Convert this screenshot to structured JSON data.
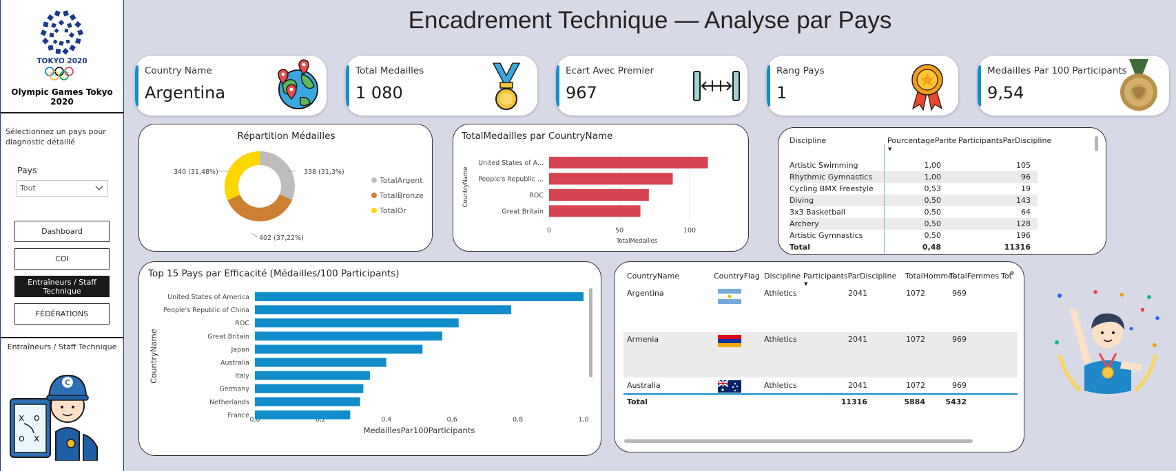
{
  "app": {
    "title": "Encadrement Technique — Analyse par Pays",
    "olympic_title": "Olympic Games Tokyo 2020",
    "logo_text": "TOKYO 2020"
  },
  "sidebar": {
    "hint": "Sélectionnez un pays pour diagnostic détaillé",
    "filter_label": "Pays",
    "filter_value": "Tout",
    "nav": [
      {
        "label": "Dashboard",
        "active": false
      },
      {
        "label": "COI",
        "active": false
      },
      {
        "label": "Entraîneurs / Staff Technique",
        "active": true
      },
      {
        "label": "FÉDÉRATIONS",
        "active": false
      }
    ],
    "section_label": "Entraîneurs / Staff Technique"
  },
  "kpis": [
    {
      "label": "Country Name",
      "value": "Argentina",
      "icon": "globe-pins-icon"
    },
    {
      "label": "Total Medailles",
      "value": "1 080",
      "icon": "medal-ribbon-icon"
    },
    {
      "label": "Ecart Avec Premier",
      "value": "967",
      "icon": "width-measure-icon"
    },
    {
      "label": "Rang Pays",
      "value": "1",
      "icon": "award-rosette-icon"
    },
    {
      "label": "Medailles Par 100 Participants",
      "value": "9,54",
      "icon": "gold-medal-icon"
    }
  ],
  "donut": {
    "title": "Répartition Médailles",
    "labels": [
      "338 (31,3%)",
      "402 (37,22%)",
      "340 (31,48%)"
    ],
    "legend": [
      "TotalArgent",
      "TotalBronze",
      "TotalOr"
    ],
    "colors": {
      "argent": "#bdbdbd",
      "bronze": "#cd7f32",
      "or": "#ffd700"
    }
  },
  "chart_data": [
    {
      "type": "pie",
      "title": "Répartition Médailles",
      "categories": [
        "TotalArgent",
        "TotalBronze",
        "TotalOr"
      ],
      "values": [
        338,
        402,
        340
      ],
      "labels": [
        "338 (31,3%)",
        "402 (37,22%)",
        "340 (31,48%)"
      ],
      "legend_placement": "right"
    },
    {
      "type": "bar",
      "orientation": "horizontal",
      "title": "TotalMedailles par CountryName",
      "categories": [
        "United States of A...",
        "People's Republic ...",
        "ROC",
        "Great Britain"
      ],
      "values": [
        113,
        88,
        71,
        65
      ],
      "xlabel": "TotalMedailles",
      "ylabel": "CountryName",
      "xticks": [
        "0",
        "50",
        "100"
      ],
      "xlim": [
        0,
        125
      ],
      "color": "#d64550"
    },
    {
      "type": "bar",
      "orientation": "horizontal",
      "title": "Top 15 Pays par Efficacité (Médailles/100 Participants)",
      "categories": [
        "United States of America",
        "People's Republic of China",
        "ROC",
        "Great Britain",
        "Japan",
        "Australia",
        "Italy",
        "Germany",
        "Netherlands",
        "France"
      ],
      "values": [
        1.0,
        0.78,
        0.62,
        0.57,
        0.51,
        0.4,
        0.35,
        0.33,
        0.32,
        0.29
      ],
      "xlabel": "MedaillesPar100Participants",
      "ylabel": "CountryName",
      "xticks": [
        "0,0",
        "0,2",
        "0,4",
        "0,6",
        "0,8",
        "1,0"
      ],
      "xlim": [
        0,
        1.0
      ],
      "color": "#118dcb"
    }
  ],
  "discipline_table": {
    "headers": [
      "Discipline",
      "PourcentageParite",
      "ParticipantsParDiscipline"
    ],
    "rows": [
      [
        "Artistic Swimming",
        "1,00",
        "105"
      ],
      [
        "Rhythmic Gymnastics",
        "1,00",
        "96"
      ],
      [
        "Cycling BMX Freestyle",
        "0,53",
        "19"
      ],
      [
        "Diving",
        "0,50",
        "143"
      ],
      [
        "3x3 Basketball",
        "0,50",
        "64"
      ],
      [
        "Archery",
        "0,50",
        "128"
      ],
      [
        "Artistic Gymnastics",
        "0,50",
        "196"
      ]
    ],
    "total": [
      "Total",
      "0,48",
      "11316"
    ]
  },
  "country_table": {
    "headers": [
      "CountryName",
      "CountryFlag",
      "Discipline",
      "ParticipantsParDiscipline",
      "TotalHommes",
      "TotalFemmes",
      "Tot"
    ],
    "rows": [
      {
        "country": "Argentina",
        "flag": "argentina-flag-icon",
        "discipline": "Athletics",
        "participants": "2041",
        "hommes": "1072",
        "femmes": "969"
      },
      {
        "country": "Armenia",
        "flag": "armenia-flag-icon",
        "discipline": "Athletics",
        "participants": "2041",
        "hommes": "1072",
        "femmes": "969"
      },
      {
        "country": "Australia",
        "flag": "australia-flag-icon",
        "discipline": "Athletics",
        "participants": "2041",
        "hommes": "1072",
        "femmes": "969"
      }
    ],
    "total": [
      "Total",
      "11316",
      "5884",
      "5432"
    ]
  }
}
